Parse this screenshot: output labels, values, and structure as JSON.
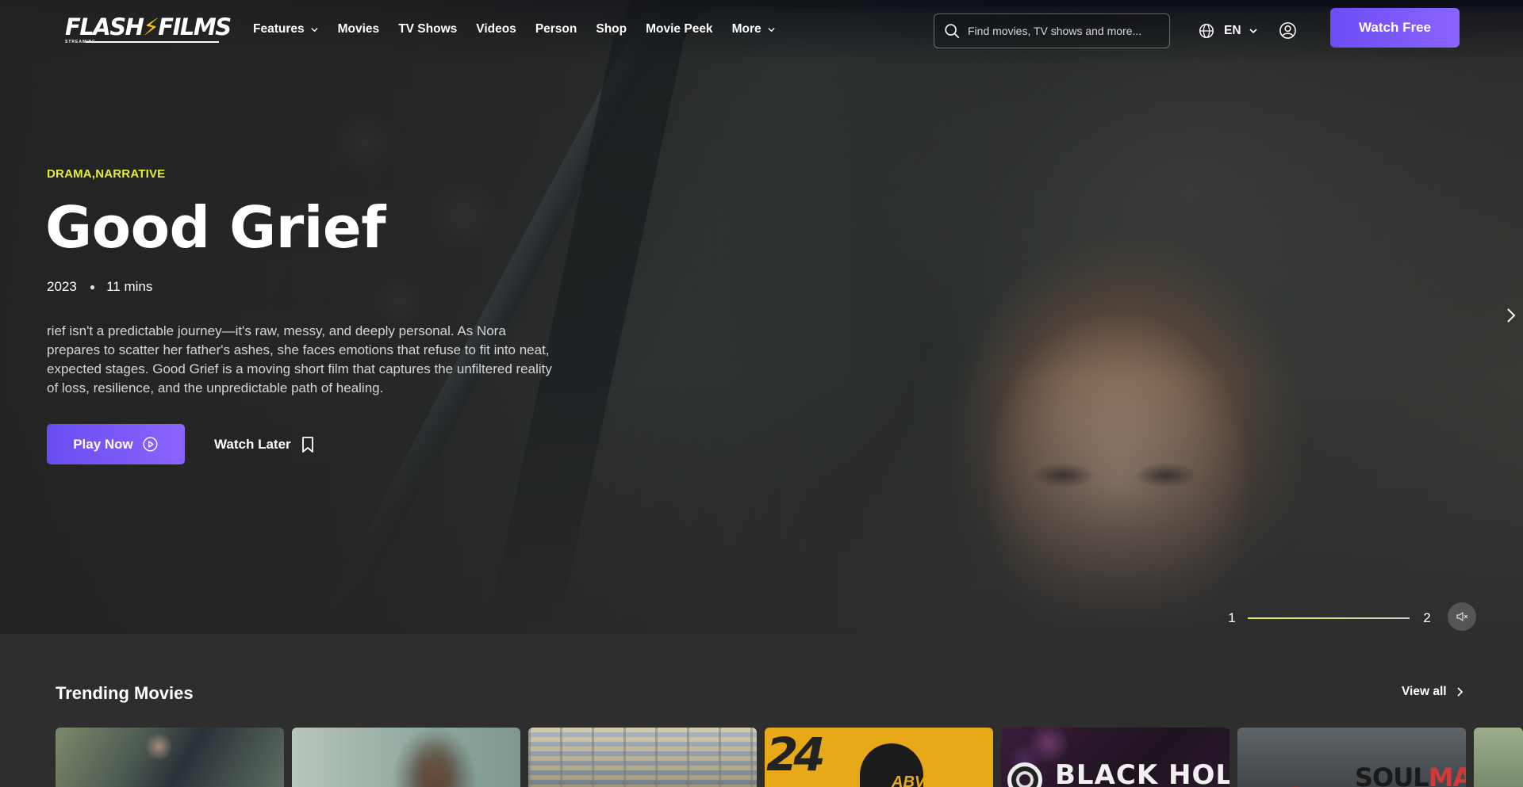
{
  "header": {
    "logo": {
      "text_left": "FLASH",
      "text_right": "FILMS",
      "subtitle": "STREAMING"
    },
    "nav": [
      {
        "label": "Features",
        "dropdown": true
      },
      {
        "label": "Movies",
        "dropdown": false
      },
      {
        "label": "TV Shows",
        "dropdown": false
      },
      {
        "label": "Videos",
        "dropdown": false
      },
      {
        "label": "Person",
        "dropdown": false
      },
      {
        "label": "Shop",
        "dropdown": false
      },
      {
        "label": "Movie Peek",
        "dropdown": false
      },
      {
        "label": "More",
        "dropdown": true
      }
    ],
    "search": {
      "placeholder": "Find movies, TV shows and more...",
      "icon": "search-icon"
    },
    "language": {
      "label": "EN",
      "icon": "globe-icon"
    },
    "user_icon": "user-icon",
    "cta_label": "Watch Free"
  },
  "hero": {
    "genres": "DRAMA,NARRATIVE",
    "title": "Good Grief",
    "year": "2023",
    "duration": "11 mins",
    "description": "rief isn't a predictable journey—it's raw, messy, and deeply personal. As Nora prepares to scatter her father's ashes, she faces emotions that refuse to fit into neat, expected stages. Good Grief is a moving short film that captures the unfiltered reality of loss, resilience, and the unpredictable path of healing.",
    "play_label": "Play Now",
    "watch_later_label": "Watch Later"
  },
  "slider": {
    "current": "1",
    "total": "2",
    "progress": 0.0,
    "accent": "#e4ef3a"
  },
  "trending": {
    "title": "Trending Movies",
    "view_all_label": "View all",
    "cards": [
      {
        "text": ""
      },
      {
        "text": ""
      },
      {
        "text": ""
      },
      {
        "text": "24",
        "tag": "ABV"
      },
      {
        "text": "BLACK HOLE!"
      },
      {
        "text_left": "SOUL",
        "text_right": "MATE"
      },
      {
        "text": ""
      }
    ]
  },
  "colors": {
    "primary": "#7b59fa",
    "accent": "#e4ef3a",
    "background": "#2e2e2e"
  }
}
